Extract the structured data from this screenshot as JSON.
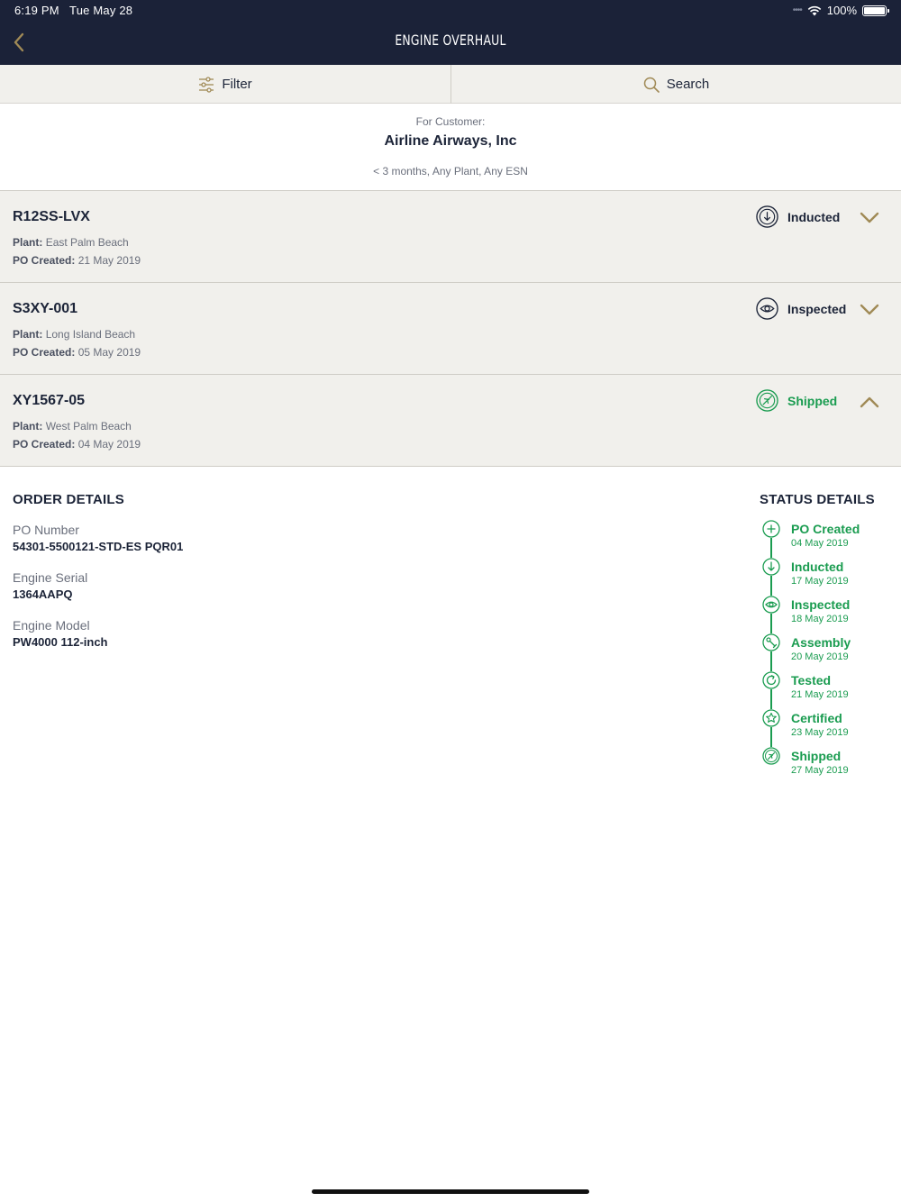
{
  "status_bar": {
    "time": "6:19 PM",
    "date": "Tue May 28",
    "battery": "100%"
  },
  "header": {
    "title": "ENGINE OVERHAUL"
  },
  "toolbar": {
    "filter_label": "Filter",
    "search_label": "Search"
  },
  "customer": {
    "label": "For Customer:",
    "name": "Airline Airways, Inc",
    "filter_summary": "< 3 months, Any Plant, Any ESN"
  },
  "colors": {
    "navy": "#1b2238",
    "gold": "#a08a56",
    "green": "#1a9c50",
    "panel": "#f1f0ec"
  },
  "orders": [
    {
      "id": "R12SS-LVX",
      "plant_label": "Plant:",
      "plant": "East Palm Beach",
      "po_label": "PO Created:",
      "po_created": "21 May 2019",
      "status": "Inducted",
      "status_icon": "inducted-arrow-icon",
      "expanded": false
    },
    {
      "id": "S3XY-001",
      "plant_label": "Plant:",
      "plant": "Long Island Beach",
      "po_label": "PO Created:",
      "po_created": "05 May 2019",
      "status": "Inspected",
      "status_icon": "eye-icon",
      "expanded": false
    },
    {
      "id": "XY1567-05",
      "plant_label": "Plant:",
      "plant": "West Palm Beach",
      "po_label": "PO Created:",
      "po_created": "04 May 2019",
      "status": "Shipped",
      "status_icon": "plane-icon",
      "expanded": true
    }
  ],
  "order_details": {
    "title": "ORDER DETAILS",
    "fields": [
      {
        "label": "PO Number",
        "value": "54301-5500121-STD-ES PQR01"
      },
      {
        "label": "Engine Serial",
        "value": "1364AAPQ"
      },
      {
        "label": "Engine Model",
        "value": "PW4000 112-inch"
      }
    ]
  },
  "status_details": {
    "title": "STATUS DETAILS",
    "steps": [
      {
        "name": "PO Created",
        "date": "04 May 2019",
        "icon": "plus-icon"
      },
      {
        "name": "Inducted",
        "date": "17 May 2019",
        "icon": "inducted-arrow-icon"
      },
      {
        "name": "Inspected",
        "date": "18 May 2019",
        "icon": "eye-icon"
      },
      {
        "name": "Assembly",
        "date": "20 May 2019",
        "icon": "wrench-icon"
      },
      {
        "name": "Tested",
        "date": "21 May 2019",
        "icon": "refresh-icon"
      },
      {
        "name": "Certified",
        "date": "23 May 2019",
        "icon": "star-icon"
      },
      {
        "name": "Shipped",
        "date": "27 May 2019",
        "icon": "plane-icon"
      }
    ]
  }
}
